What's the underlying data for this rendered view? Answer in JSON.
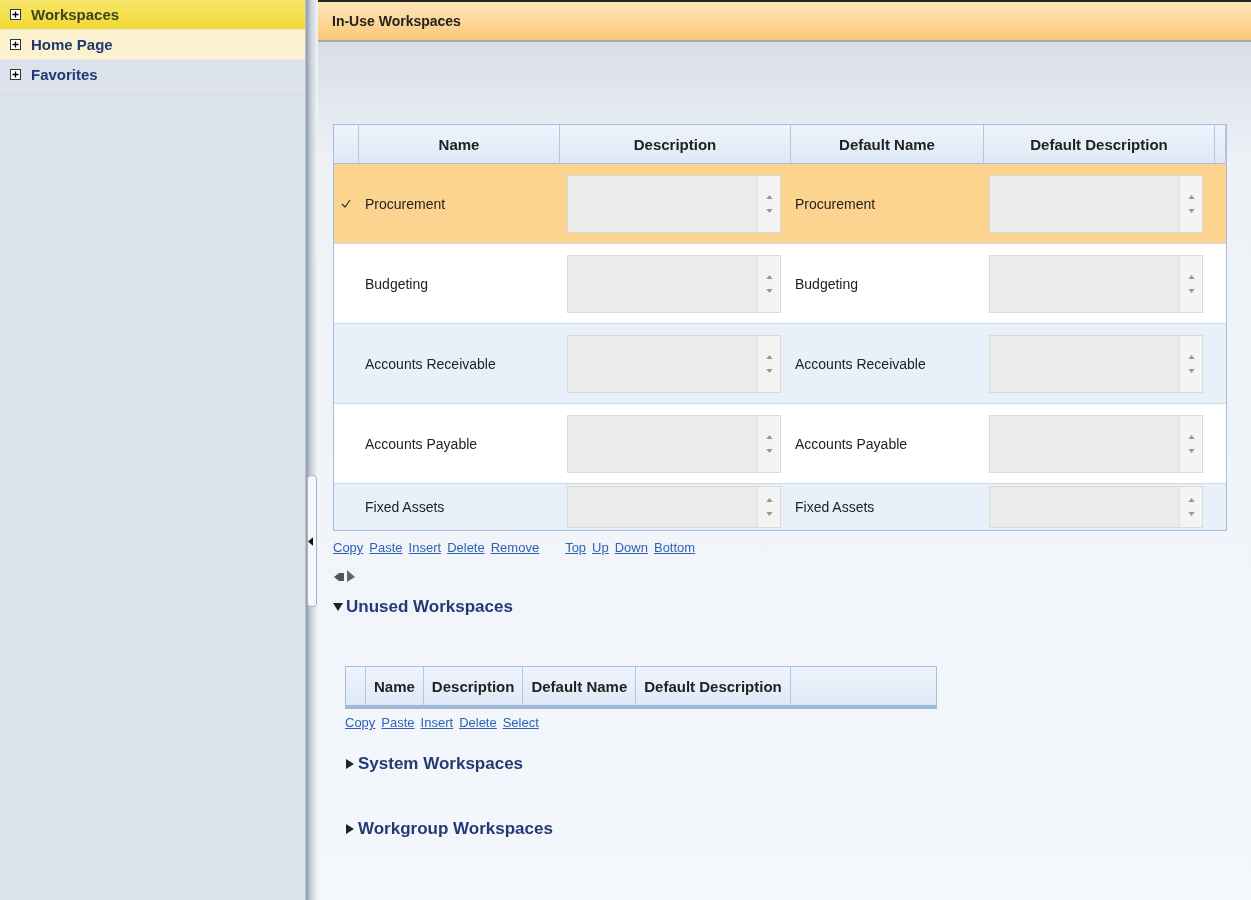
{
  "sidebar": {
    "items": [
      {
        "label": "Workspaces",
        "selected": true,
        "hovered": false,
        "expanded": false
      },
      {
        "label": "Home Page",
        "selected": false,
        "hovered": true,
        "expanded": false
      },
      {
        "label": "Favorites",
        "selected": false,
        "hovered": false,
        "expanded": false
      }
    ]
  },
  "header": {
    "title": "In-Use Workspaces"
  },
  "in_use_table": {
    "columns": [
      "Name",
      "Description",
      "Default Name",
      "Default Description"
    ],
    "rows": [
      {
        "name": "Procurement",
        "default_name": "Procurement",
        "selected": true
      },
      {
        "name": "Budgeting",
        "default_name": "Budgeting",
        "selected": false
      },
      {
        "name": "Accounts Receivable",
        "default_name": "Accounts Receivable",
        "selected": false
      },
      {
        "name": "Accounts Payable",
        "default_name": "Accounts Payable",
        "selected": false
      },
      {
        "name": "Fixed Assets",
        "default_name": "Fixed Assets",
        "selected": false
      }
    ],
    "actions": [
      [
        "Copy",
        "Paste",
        "Insert",
        "Delete",
        "Remove"
      ],
      [
        "Top",
        "Up",
        "Down",
        "Bottom"
      ]
    ]
  },
  "unused_section": {
    "title": "Unused Workspaces",
    "expanded": true,
    "columns": [
      "Name",
      "Description",
      "Default Name",
      "Default Description"
    ],
    "actions": [
      "Copy",
      "Paste",
      "Insert",
      "Delete",
      "Select"
    ]
  },
  "sections": [
    {
      "title": "System Workspaces",
      "expanded": false
    },
    {
      "title": "Workgroup Workspaces",
      "expanded": false
    }
  ]
}
